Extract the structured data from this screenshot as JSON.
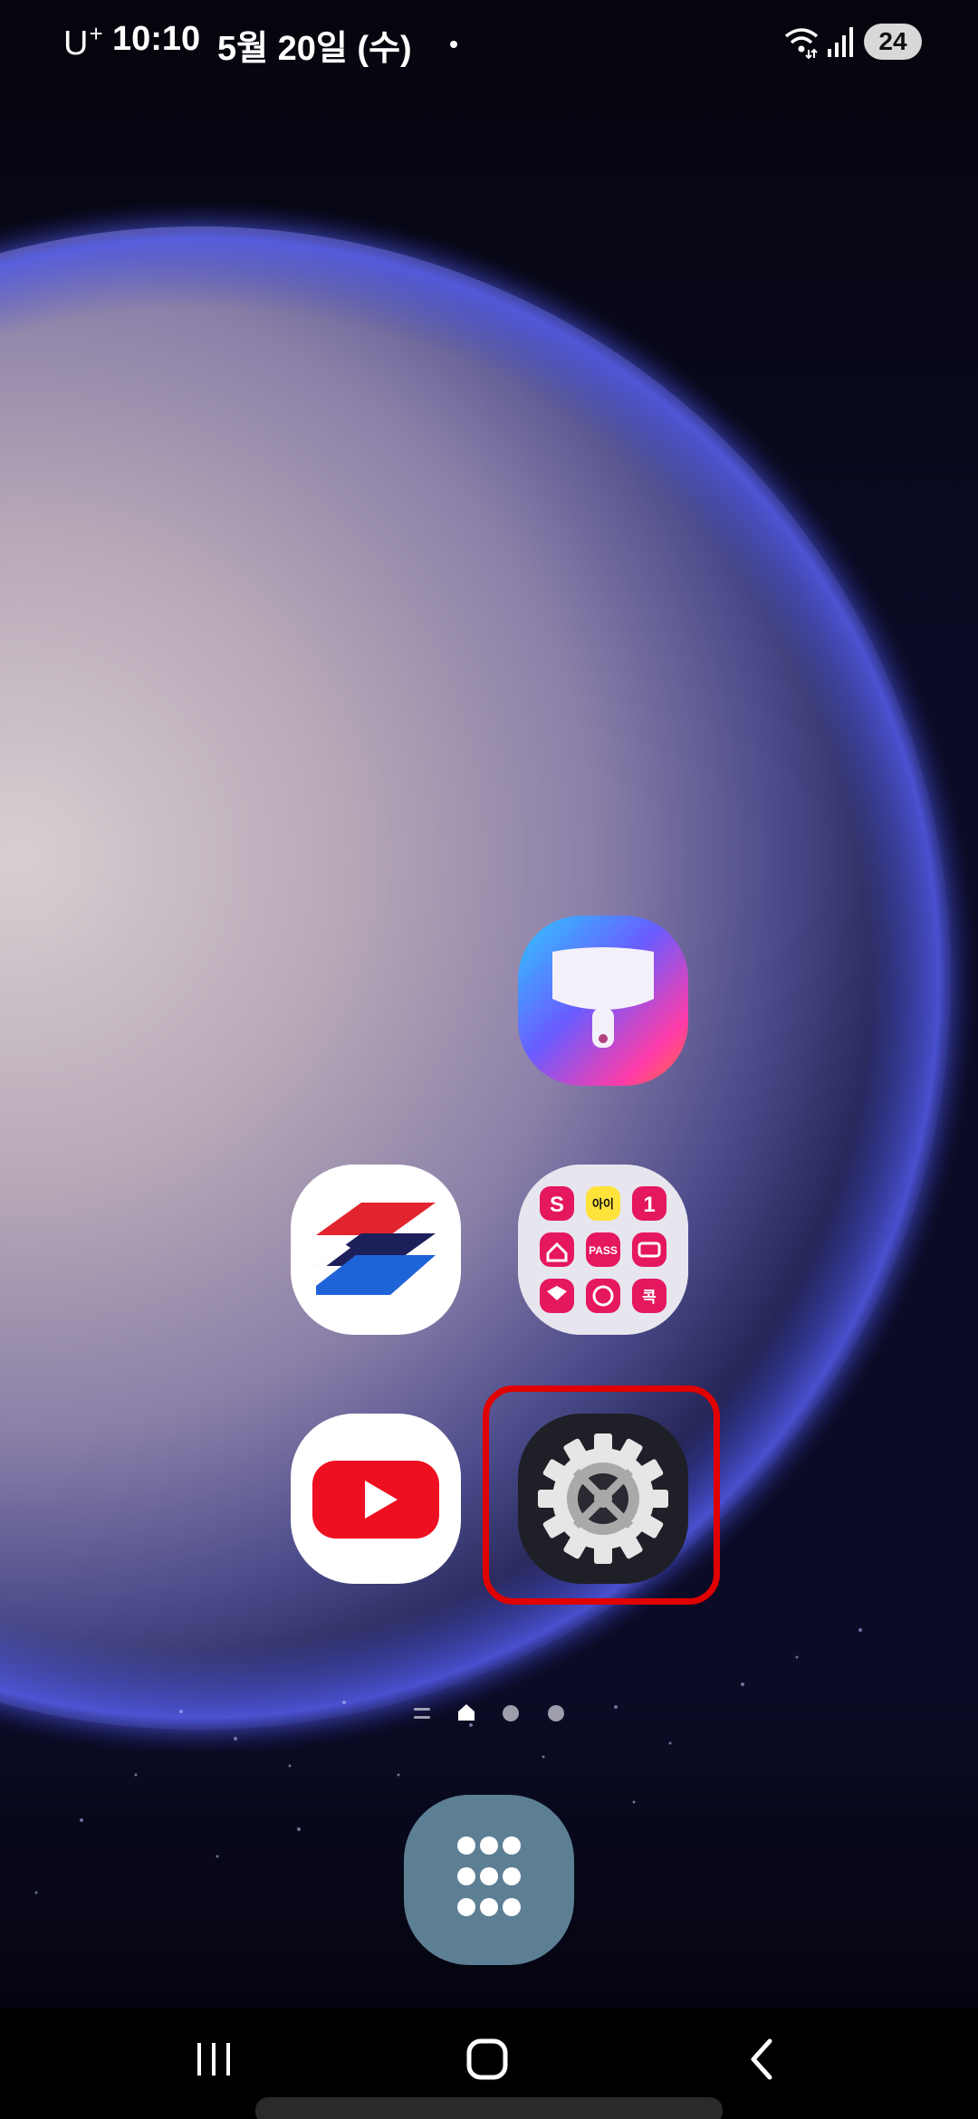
{
  "status_bar": {
    "carrier": "U",
    "carrier_sup": "+",
    "time": "10:10",
    "date": "5월 20일 (수)",
    "battery": "24",
    "icons": [
      "wifi-6-icon",
      "signal-icon"
    ]
  },
  "home": {
    "apps": [
      {
        "name": "theme-park-app",
        "icon": "paint-brush-icon"
      },
      {
        "name": "bank-app",
        "icon": "shinhan-logo-icon"
      },
      {
        "name": "app-folder",
        "icon": "folder-grid-icon",
        "folder_labels": [
          "S",
          "아이",
          "1",
          "PASS",
          "콕"
        ]
      },
      {
        "name": "youtube-app",
        "icon": "youtube-play-icon"
      },
      {
        "name": "settings-app",
        "icon": "gear-icon",
        "highlighted": true
      }
    ],
    "page_indicator": {
      "pages": 3,
      "current": 1,
      "icons": [
        "page-list-icon",
        "home-page-icon"
      ]
    }
  },
  "dock": {
    "icon": "app-drawer-grid-icon"
  },
  "nav_bar": {
    "icons": [
      "recent-apps-icon",
      "home-icon",
      "back-icon"
    ]
  },
  "colors": {
    "highlight": "#e10000",
    "drawer": "#5d7f94"
  }
}
